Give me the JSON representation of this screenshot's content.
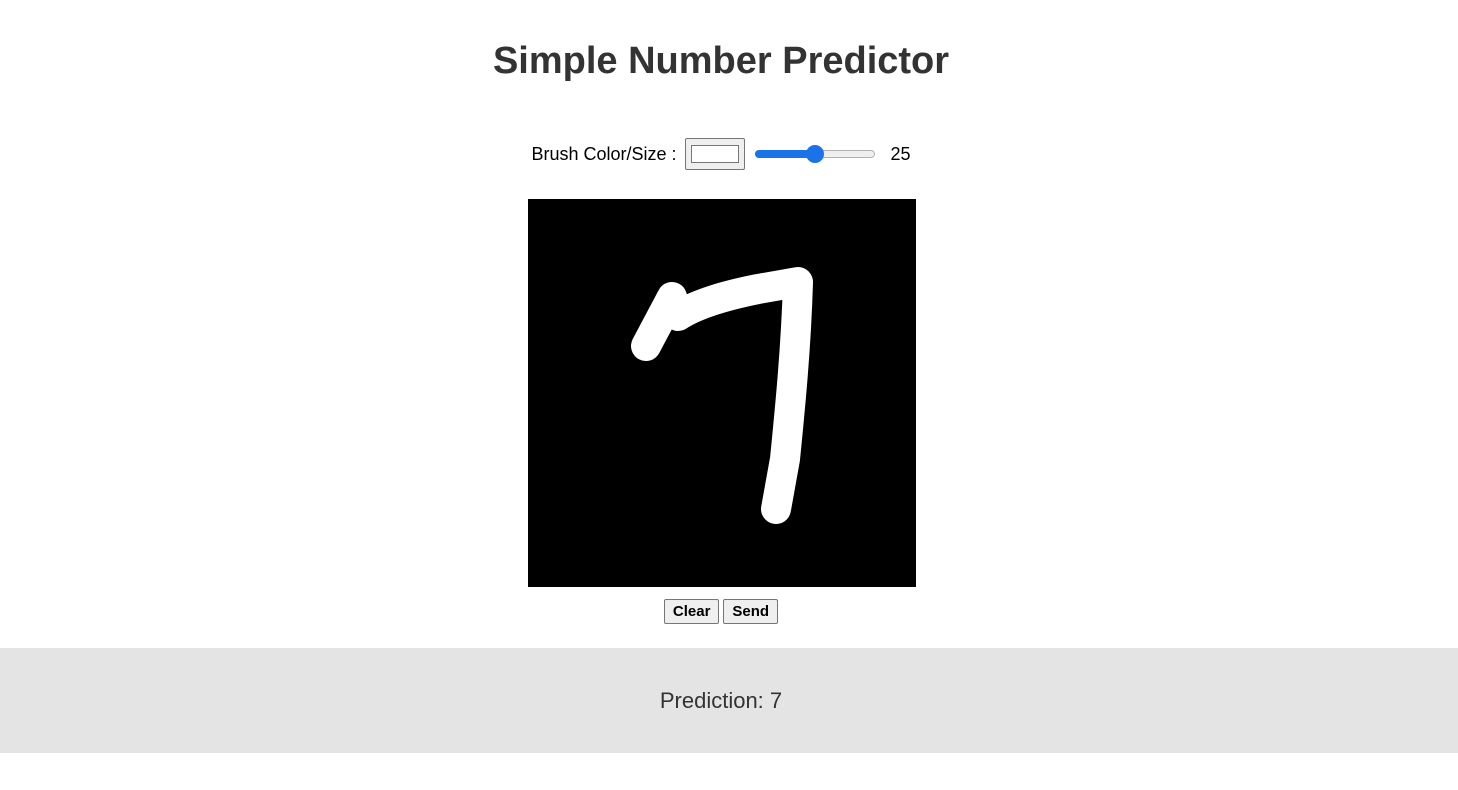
{
  "header": {
    "title": "Simple Number Predictor"
  },
  "controls": {
    "brush_label": "Brush Color/Size :",
    "brush_color": "#ffffff",
    "brush_size_value": "25",
    "brush_size_fraction": 0.5
  },
  "canvas": {
    "background_color": "#000000",
    "stroke_color": "#ffffff"
  },
  "buttons": {
    "clear_label": "Clear",
    "send_label": "Send"
  },
  "result": {
    "prediction_text": "Prediction: 7"
  },
  "colors": {
    "accent": "#1a73e8",
    "title_text": "#333333",
    "result_bar": "#e4e4e4"
  }
}
